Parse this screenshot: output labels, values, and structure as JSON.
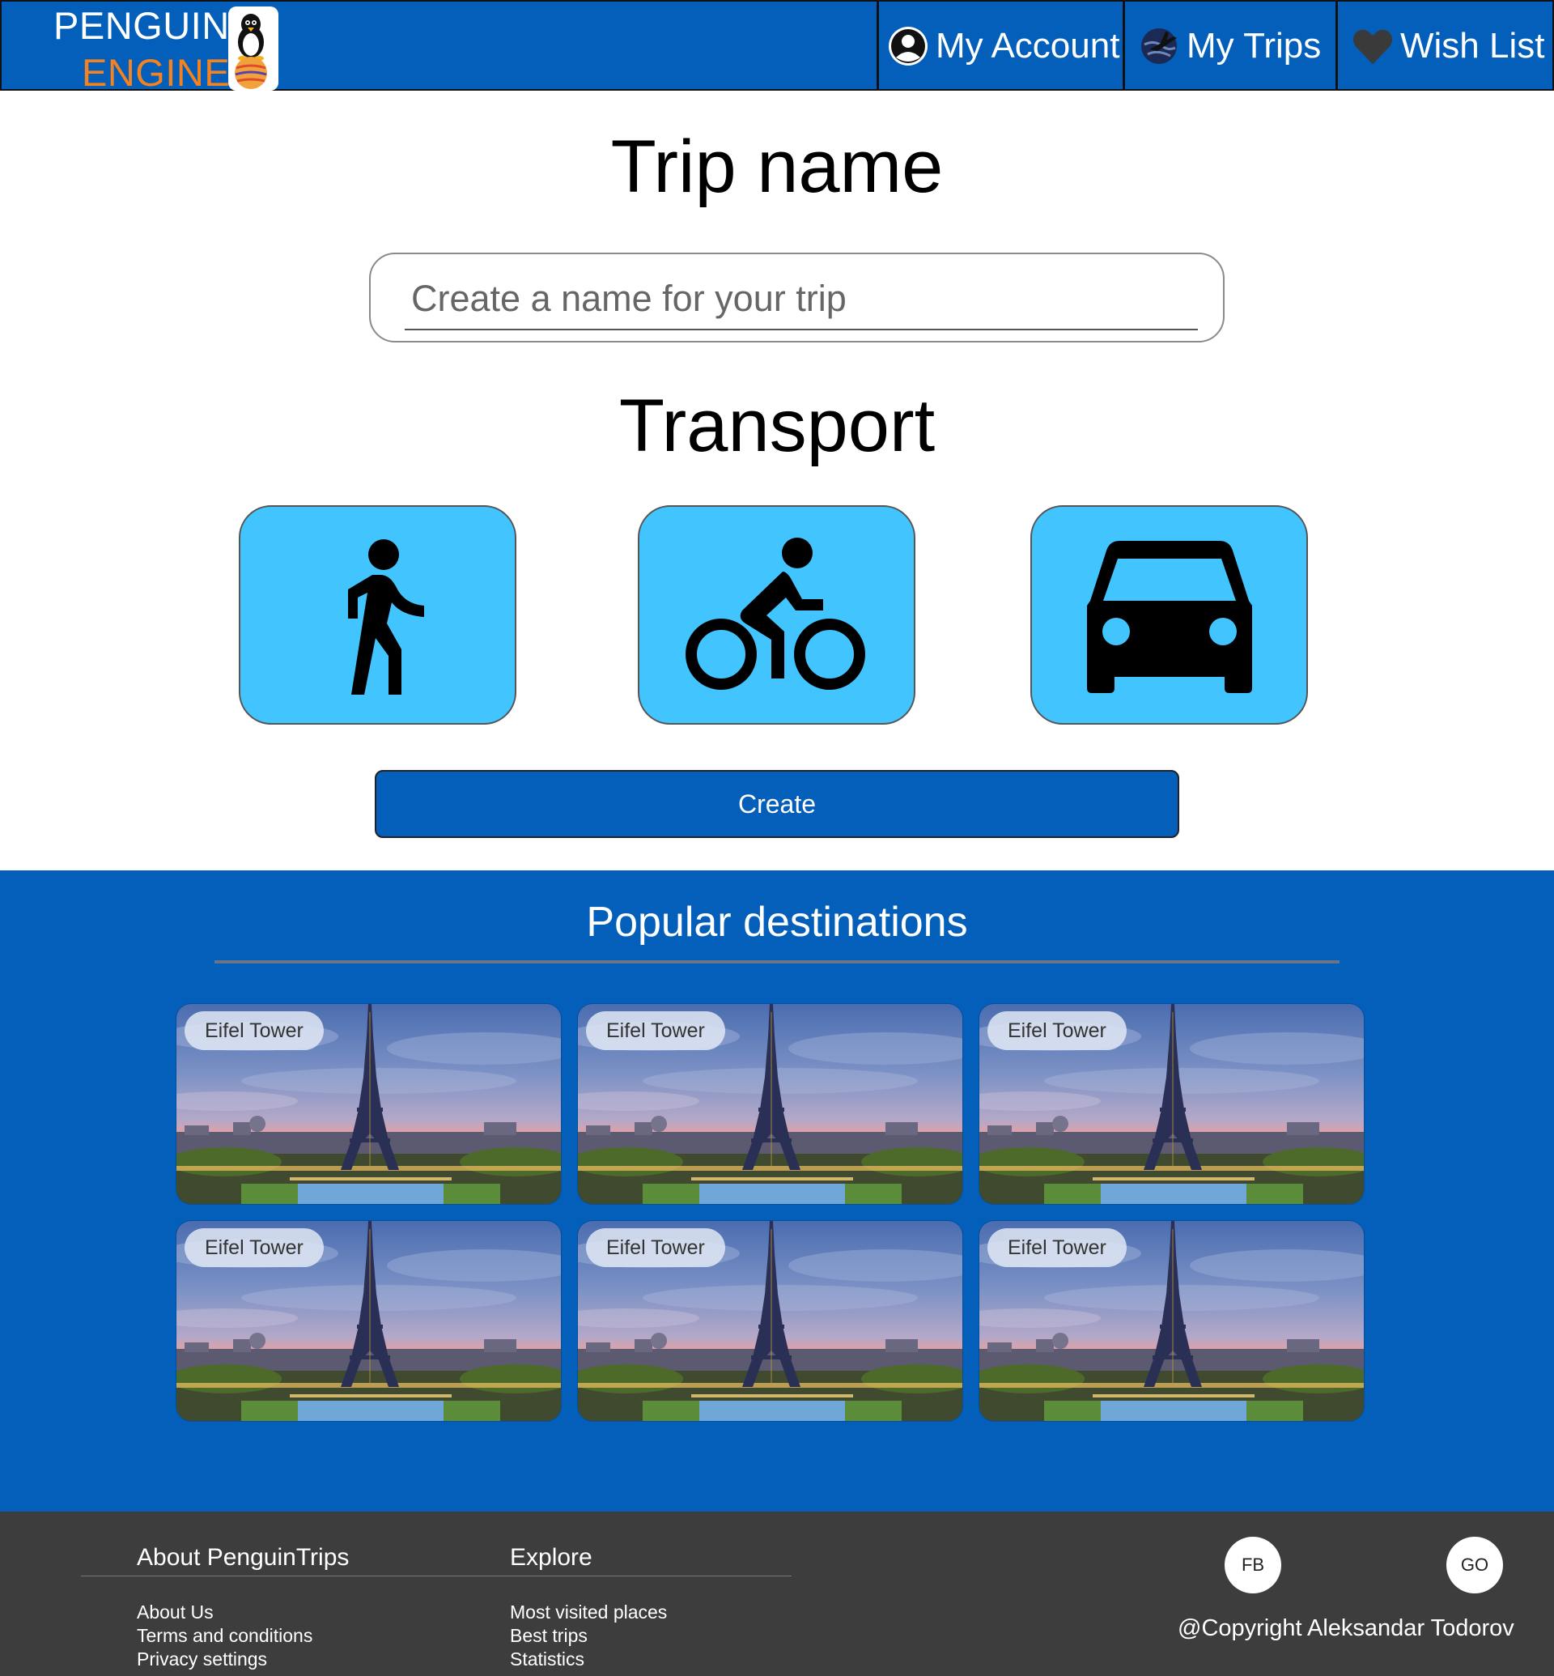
{
  "header": {
    "logo": {
      "line1": "PENGUIN",
      "line2": "ENGINE"
    },
    "nav": [
      {
        "label": "My Account",
        "icon": "account-circle-icon"
      },
      {
        "label": "My Trips",
        "icon": "globe-plane-icon"
      },
      {
        "label": "Wish List",
        "icon": "heart-icon"
      }
    ]
  },
  "form": {
    "trip_name_title": "Trip name",
    "trip_name_placeholder": "Create a name for your trip",
    "trip_name_value": "",
    "transport_title": "Transport",
    "transport_options": [
      {
        "icon": "walking-person-icon"
      },
      {
        "icon": "bicycle-rider-icon"
      },
      {
        "icon": "car-icon"
      }
    ],
    "create_label": "Create"
  },
  "popular": {
    "title": "Popular destinations",
    "cards": [
      {
        "label": "Eifel Tower"
      },
      {
        "label": "Eifel Tower"
      },
      {
        "label": "Eifel Tower"
      },
      {
        "label": "Eifel Tower"
      },
      {
        "label": "Eifel Tower"
      },
      {
        "label": "Eifel Tower"
      }
    ]
  },
  "footer": {
    "about": {
      "heading": "About PenguinTrips",
      "links": [
        "About Us",
        "Terms and conditions",
        "Privacy settings"
      ]
    },
    "explore": {
      "heading": "Explore",
      "links": [
        "Most visited places",
        "Best trips",
        "Statistics"
      ]
    },
    "social": [
      "FB",
      "GO"
    ],
    "copyright": "@Copyright Aleksandar Todorov"
  },
  "colors": {
    "brand_blue": "#035fb9",
    "accent_orange": "#f4821f",
    "transport_blue": "#42c4fe",
    "footer_gray": "#3d3d3d"
  }
}
